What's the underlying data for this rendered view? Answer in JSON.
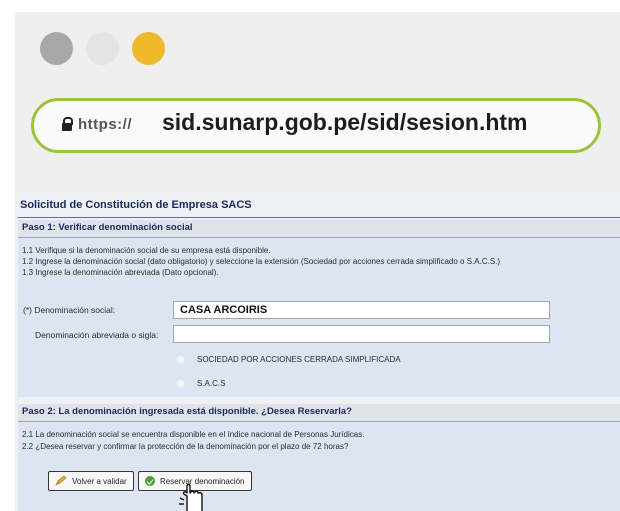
{
  "browser": {
    "dot_colors": [
      "#a8a8a8",
      "#e4e4e4",
      "#f0b92a"
    ],
    "url_protocol": "https://",
    "url_host": "sid.sunarp.gob.pe/sid/sesion.htm",
    "accent": "#9dc33a"
  },
  "form": {
    "title": "Solicitud de Constitución de Empresa SACS",
    "step1": {
      "heading": "Paso 1: Verificar denominación social",
      "instructions": [
        "1.1 Verifique si la denominación social de su empresa está disponible.",
        "1.2 Ingrese la denominación social (dato obligatorio) y seleccione la extensión (Sociedad por acciones cerrada simplificado o S.A.C.S.)",
        "1.3 Ingrese la denominación abreviada (Dato opcional)."
      ],
      "denominacion_label": "(*) Denominación social:",
      "denominacion_value": "CASA ARCOIRIS",
      "abreviada_label": "Denominación abreviada o sigla:",
      "abreviada_value": "",
      "options": [
        "SOCIEDAD POR ACCIONES CERRADA SIMPLIFICADA",
        "S.A.C.S"
      ]
    },
    "step2": {
      "heading": "Paso 2: La denominación ingresada está disponible. ¿Desea Reservarla?",
      "instructions": [
        "2.1 La denominación social se encuentra disponible en el índice nacional de Personas Jurídicas.",
        "2.2 ¿Desea reservar y confirmar la protección de la denominación por el plazo de 72 horas?"
      ],
      "btn_validate": "Volver a validar",
      "btn_reserve": "Reservar denominación"
    }
  },
  "icons": {
    "lock": "lock-icon",
    "pencil": "pencil-icon",
    "ok": "check-circle-icon",
    "cursor": "hand-cursor-icon"
  }
}
